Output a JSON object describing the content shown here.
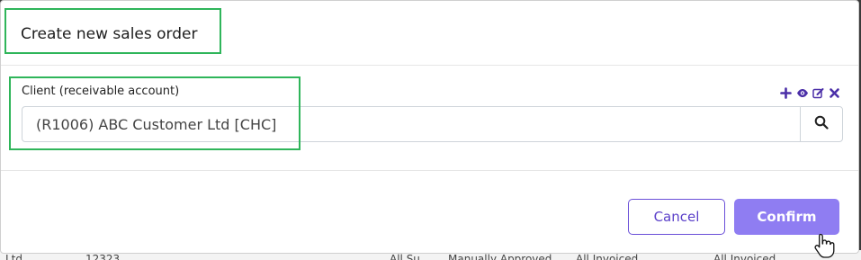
{
  "background_row": {
    "cells": [
      "Ltd",
      "12323",
      "All Su",
      "Manually Approved",
      "All Invoiced",
      "All Invoiced"
    ]
  },
  "modal": {
    "title": "Create new sales order",
    "field": {
      "label": "Client (receivable account)",
      "value": "(R1006) ABC Customer Ltd [CHC]",
      "actions": [
        "add-icon",
        "view-icon",
        "edit-icon",
        "remove-icon"
      ],
      "action_color": "#4b2fa8"
    },
    "buttons": {
      "cancel": "Cancel",
      "confirm": "Confirm"
    }
  },
  "colors": {
    "highlight": "#2fb55a",
    "accent": "#6a4fd8",
    "confirm_bg": "#8f7df2"
  }
}
